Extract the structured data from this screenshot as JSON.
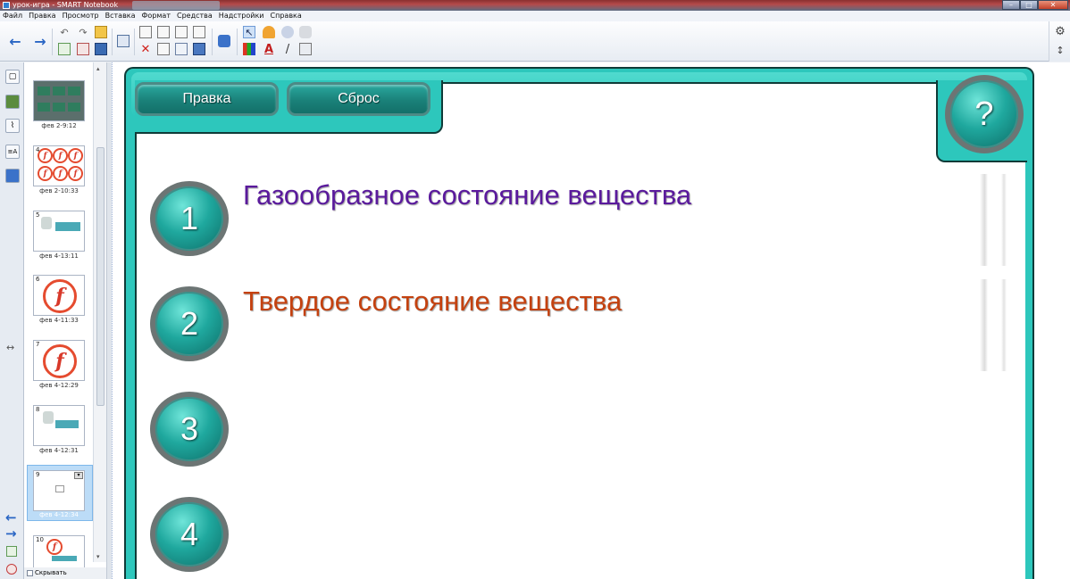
{
  "window": {
    "title": "урок-игра - SMART Notebook"
  },
  "menu": [
    "Файл",
    "Правка",
    "Просмотр",
    "Вставка",
    "Формат",
    "Средства",
    "Надстройки",
    "Справка"
  ],
  "icons": {
    "back": "←",
    "forward": "→",
    "undo": "↶",
    "redo": "↷",
    "delete": "✕",
    "pointer": "↖",
    "text": "A",
    "line": "/",
    "gear": "⚙",
    "arrows_updown": "↕",
    "tab_expand": "↔"
  },
  "sorter": {
    "pages": [
      {
        "num": "",
        "date": "фев 2-9:12"
      },
      {
        "num": "4",
        "date": "фев 2-10:33"
      },
      {
        "num": "5",
        "date": "фев 4-13:11"
      },
      {
        "num": "6",
        "date": "фев 4-11:33"
      },
      {
        "num": "7",
        "date": "фев 4-12:29"
      },
      {
        "num": "8",
        "date": "фев 4-12:31"
      },
      {
        "num": "9",
        "date": "фев 4-12:34"
      },
      {
        "num": "10",
        "date": ""
      }
    ],
    "auto_hide_label": "Скрывать автоматическ"
  },
  "board": {
    "buttons": {
      "edit": "Правка",
      "reset": "Сброс",
      "help": "?"
    },
    "rows": [
      {
        "num": "1",
        "answer": "Газообразное состояние вещества",
        "color": "#5a1a9c"
      },
      {
        "num": "2",
        "answer": "Твердое состояние вещества",
        "color": "#c4410f"
      },
      {
        "num": "3",
        "answer": "",
        "color": "#000000"
      },
      {
        "num": "4",
        "answer": "",
        "color": "#000000"
      }
    ]
  }
}
